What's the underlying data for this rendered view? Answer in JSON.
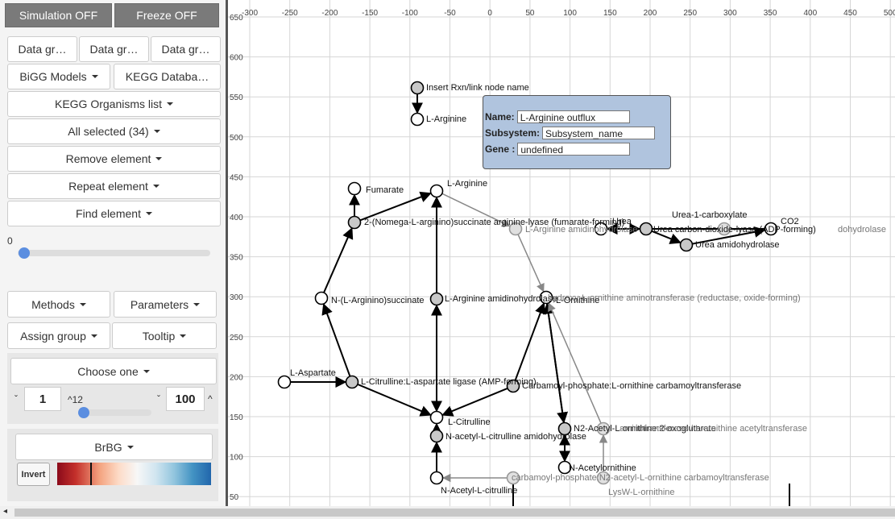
{
  "toolbar": {
    "simulation": "Simulation OFF",
    "freeze": "Freeze OFF",
    "data_groups": [
      "Data gr…",
      "Data gr…",
      "Data gr…"
    ],
    "bigg": "BiGG Models",
    "kegg_db": "KEGG Databa…",
    "kegg_org": "KEGG Organisms list",
    "all_selected": "All selected (34)",
    "remove": "Remove element",
    "repeat": "Repeat element",
    "find": "Find element",
    "slider_value": "0",
    "methods": "Methods",
    "parameters": "Parameters",
    "assign_group": "Assign group",
    "tooltip": "Tooltip",
    "choose_one": "Choose one",
    "min_value": "1",
    "mid_label": "^12",
    "max_value": "100",
    "palette": "BrBG",
    "invert": "Invert"
  },
  "popup": {
    "name_label": "Name:",
    "name_value": "L-Arginine outflux",
    "subsystem_label": "Subsystem:",
    "subsystem_value": "Subsystem_name",
    "gene_label": "Gene :",
    "gene_value": "undefined"
  },
  "axis": {
    "x_ticks": [
      "-300",
      "-250",
      "-200",
      "-150",
      "-100",
      "-50",
      "0",
      "50",
      "100",
      "150",
      "200",
      "250",
      "300",
      "350",
      "400",
      "450",
      "500"
    ],
    "y_ticks": [
      "650",
      "600",
      "550",
      "500",
      "450",
      "400",
      "350",
      "300",
      "250",
      "200",
      "150",
      "100",
      "50"
    ]
  },
  "node_labels": {
    "insert": "Insert Rxn/link node name",
    "arg_top": "L-Arginine",
    "fumarate": "Fumarate",
    "arg": "L-Arginine",
    "lyase": "2-(Nomega-L-arginino)succinate arginine-lyase (fumarate-forming)",
    "amidino": "L-Arginine amidinohydrolase",
    "urea1carb": "Urea-1-carboxylate",
    "co2": "CO2",
    "urea": "Urea",
    "urea_text": "Urea carbon-dioxide-lyase (ADP-forming)",
    "urea_amido": "Urea amidohydrolase",
    "dohydrolase": "dohydrolase",
    "argsucc": "N-(L-Arginino)succinate",
    "ornithine": "L-Ornithine",
    "arg_amido": "L-Arginine amidinohydrolase",
    "hydrolase_overlap": "hydroxy-L-ornithine aminotransferase (reductase, oxide-forming)",
    "aspartate": "L-Aspartate",
    "citr_lig": "L-Citrulline:L-aspartate ligase (AMP-forming)",
    "carb_orn": "Carbamoyl-phosphate:L-ornithine carbamoyltransferase",
    "citrulline": "L-Citrulline",
    "nacetyl_amido": "N-acetyl-L-citrulline amidohydrolase",
    "n2_acetyl": "N2-Acetyl-L-ornithine:2-oxoglutarate",
    "n2_acetyl_b": "aminotransferase / L-ornithine acetyltransferase",
    "n_acetylorn": "N-Acetylornithine",
    "carb_n2": "carbamoyl-phosphate:N2-acetyl-L-ornithine carbamoyltransferase",
    "nacetyl_citr": "N-Acetyl-L-citrulline",
    "lysw": "LysW-L-ornithine"
  }
}
